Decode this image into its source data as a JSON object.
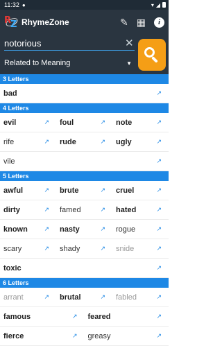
{
  "status": {
    "time": "11:32",
    "notification_icon": "message-bubble-icon"
  },
  "appbar": {
    "title": "RhymeZone",
    "logo_letters": [
      "R",
      "Z"
    ]
  },
  "search": {
    "value": "notorious",
    "mode": "Related to Meaning"
  },
  "sections": [
    {
      "header": "3 Letters",
      "rows": [
        [
          {
            "word": "bad",
            "weight": "strong"
          }
        ]
      ]
    },
    {
      "header": "4 Letters",
      "rows": [
        [
          {
            "word": "evil",
            "weight": "strong"
          },
          {
            "word": "foul",
            "weight": "strong"
          },
          {
            "word": "note",
            "weight": "strong"
          }
        ],
        [
          {
            "word": "rife",
            "weight": "medium"
          },
          {
            "word": "rude",
            "weight": "strong"
          },
          {
            "word": "ugly",
            "weight": "strong"
          }
        ],
        [
          {
            "word": "vile",
            "weight": "medium"
          }
        ]
      ]
    },
    {
      "header": "5 Letters",
      "rows": [
        [
          {
            "word": "awful",
            "weight": "strong"
          },
          {
            "word": "brute",
            "weight": "strong"
          },
          {
            "word": "cruel",
            "weight": "strong"
          }
        ],
        [
          {
            "word": "dirty",
            "weight": "strong"
          },
          {
            "word": "famed",
            "weight": "medium"
          },
          {
            "word": "hated",
            "weight": "strong"
          }
        ],
        [
          {
            "word": "known",
            "weight": "strong"
          },
          {
            "word": "nasty",
            "weight": "strong"
          },
          {
            "word": "rogue",
            "weight": "medium"
          }
        ],
        [
          {
            "word": "scary",
            "weight": "medium"
          },
          {
            "word": "shady",
            "weight": "medium"
          },
          {
            "word": "snide",
            "weight": "light"
          }
        ],
        [
          {
            "word": "toxic",
            "weight": "strong"
          }
        ]
      ]
    },
    {
      "header": "6 Letters",
      "rows": [
        [
          {
            "word": "arrant",
            "weight": "light"
          },
          {
            "word": "brutal",
            "weight": "strong"
          },
          {
            "word": "fabled",
            "weight": "light"
          }
        ],
        [
          {
            "word": "famous",
            "weight": "strong"
          },
          {
            "word": "feared",
            "weight": "strong"
          }
        ],
        [
          {
            "word": "fierce",
            "weight": "strong"
          },
          {
            "word": "greasy",
            "weight": "medium"
          }
        ]
      ]
    }
  ],
  "colors": {
    "header_blue": "#1e88e5",
    "accent_orange": "#f59e16",
    "bar_dark": "#2a3540"
  }
}
